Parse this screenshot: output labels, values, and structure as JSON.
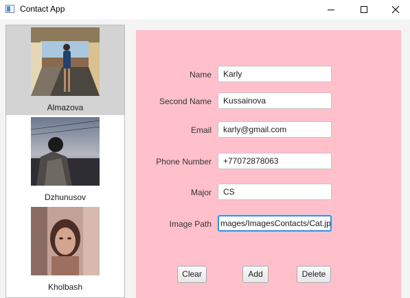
{
  "window": {
    "title": "Contact App"
  },
  "contacts": [
    {
      "name": "Almazova",
      "selected": true
    },
    {
      "name": "Dzhunusov",
      "selected": false
    },
    {
      "name": "Kholbash",
      "selected": false
    }
  ],
  "form": {
    "fields": [
      {
        "label": "Name",
        "value": "Karly"
      },
      {
        "label": "Second Name",
        "value": "Kussainova"
      },
      {
        "label": "Email",
        "value": "karly@gmail.com"
      },
      {
        "label": "Phone Number",
        "value": "+77072878063"
      },
      {
        "label": "Major",
        "value": "CS"
      },
      {
        "label": "Image Path",
        "value": "mages/ImagesContacts/Cat.jp"
      }
    ],
    "buttons": {
      "clear": "Clear",
      "add": "Add",
      "delete": "Delete"
    },
    "panel_color": "#ffc0cb"
  }
}
